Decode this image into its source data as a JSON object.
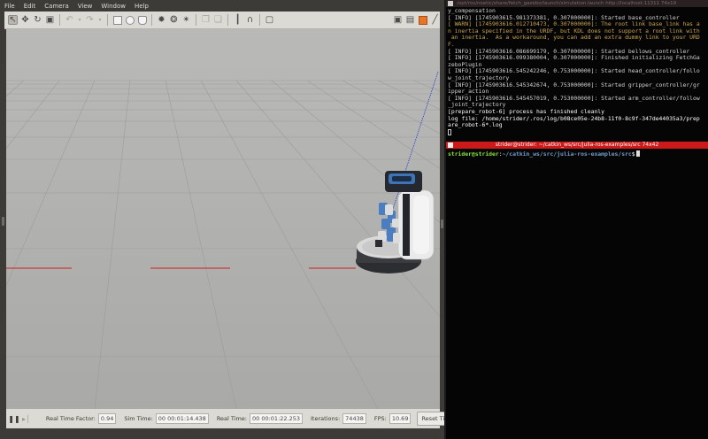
{
  "menubar": {
    "items": [
      "File",
      "Edit",
      "Camera",
      "View",
      "Window",
      "Help"
    ]
  },
  "toolbar": {
    "icons": [
      "select-arrow-icon",
      "translate-icon",
      "rotate-icon",
      "scale-icon",
      "undo-icon",
      "redo-icon",
      "box-icon",
      "sphere-icon",
      "cylinder-icon",
      "point-light-icon",
      "spot-light-icon",
      "directional-light-icon",
      "copy-icon",
      "paste-icon",
      "align-icon",
      "snap-icon",
      "change-view-icon",
      "screenshot-icon",
      "log-icon"
    ]
  },
  "status": {
    "rtf_label": "Real Time Factor:",
    "rtf_value": "0.94",
    "sim_label": "Sim Time:",
    "sim_value": "00 00:01:14.438",
    "real_label": "Real Time:",
    "real_value": "00 00:01:22.253",
    "iter_label": "Iterations:",
    "iter_value": "74438",
    "fps_label": "FPS:",
    "fps_value": "10.69",
    "reset_label": "Reset Time"
  },
  "terminal1": {
    "title": "/opt/ros/noetic/share/fetch_gazebo/launch/simulation.launch http://localhost:11311 74x19",
    "lines": [
      {
        "t": "y_compensation",
        "c": "info"
      },
      {
        "t": "[ INFO] [1745903615.981373381, 0.307000000]: Started base_controller",
        "c": "info"
      },
      {
        "t": "[ WARN] [1745903616.012710473, 0.307000000]: The root link base_link has a",
        "c": "warn"
      },
      {
        "t": "n inertia specified in the URDF, but KDL does not support a root link with",
        "c": "warn"
      },
      {
        "t": " an inertia.  As a workaround, you can add an extra dummy link to your URD",
        "c": "warn"
      },
      {
        "t": "F.",
        "c": "warn"
      },
      {
        "t": "[ INFO] [1745903616.086699179, 0.307000000]: Started bellows_controller",
        "c": "info"
      },
      {
        "t": "[ INFO] [1745903616.099380004, 0.307000000]: Finished initializing FetchGa",
        "c": "info"
      },
      {
        "t": "zeboPlugin",
        "c": "info"
      },
      {
        "t": "[ INFO] [1745903616.545242246, 0.753000000]: Started head_controller/follo",
        "c": "info"
      },
      {
        "t": "w_joint_trajectory",
        "c": "info"
      },
      {
        "t": "[ INFO] [1745903616.545342674, 0.753000000]: Started gripper_controller/gr",
        "c": "info"
      },
      {
        "t": "ipper_action",
        "c": "info"
      },
      {
        "t": "[ INFO] [1745903616.545457019, 0.753000000]: Started arm_controller/follow",
        "c": "info"
      },
      {
        "t": "_joint_trajectory",
        "c": "info"
      },
      {
        "t": "[prepare_robot-6] process has finished cleanly",
        "c": "white"
      },
      {
        "t": "log file: /home/strider/.ros/log/b08ce05e-24b8-11f0-8c9f-347de44035a3/prep",
        "c": "white"
      },
      {
        "t": "are_robot-6*.log",
        "c": "white"
      }
    ]
  },
  "terminal2": {
    "title": "strider@strider: ~/catkin_ws/src/julia-ros-examples/src 74x42",
    "user": "strider@strider",
    "sep": ":",
    "path": "~/catkin_ws/src/julia-ros-examples/src",
    "dollar": "$"
  },
  "colors": {
    "warn": "#c9a54b",
    "active_title": "#cc1a1a",
    "prompt_user": "#8ae234",
    "prompt_path": "#729fcf"
  }
}
